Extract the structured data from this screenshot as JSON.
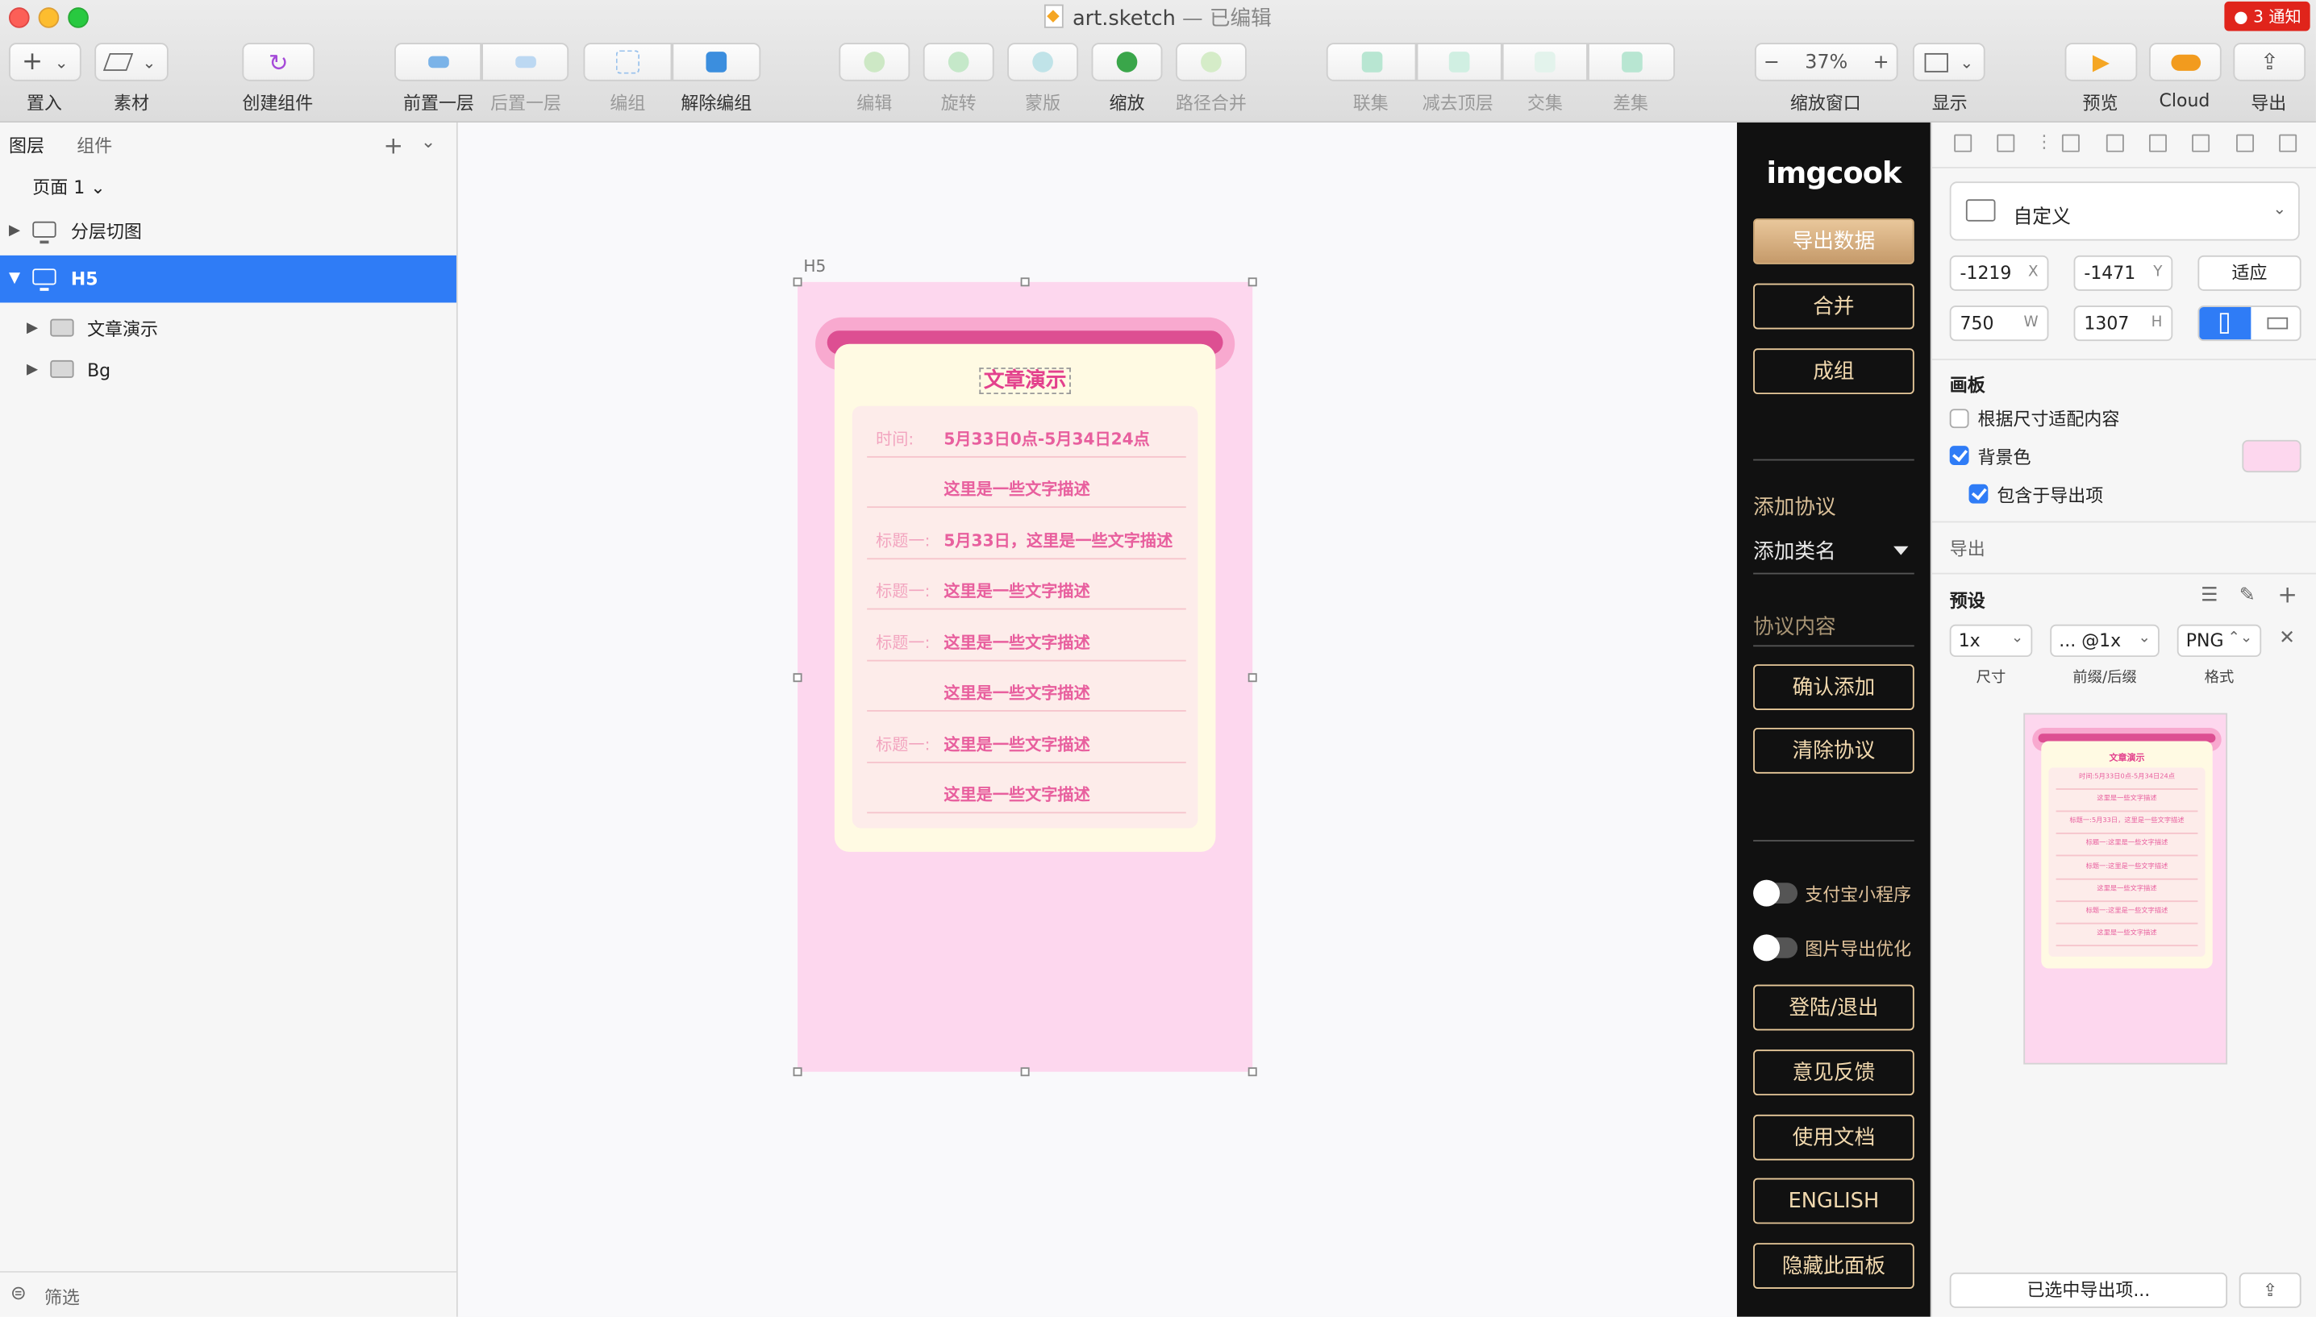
{
  "window": {
    "title": "art.sketch",
    "title_suffix": " — 已编辑",
    "notification": "● 3 通知"
  },
  "toolbar": {
    "items": [
      {
        "label": "置入",
        "state": "active"
      },
      {
        "label": "素材",
        "state": "active"
      },
      {
        "label": "创建组件",
        "state": "active"
      },
      {
        "label": "前置一层",
        "state": "active"
      },
      {
        "label": "后置一层",
        "state": "disabled"
      },
      {
        "label": "编组",
        "state": "disabled"
      },
      {
        "label": "解除编组",
        "state": "active"
      },
      {
        "label": "编辑",
        "state": "disabled"
      },
      {
        "label": "旋转",
        "state": "disabled"
      },
      {
        "label": "蒙版",
        "state": "disabled"
      },
      {
        "label": "缩放",
        "state": "active"
      },
      {
        "label": "路径合并",
        "state": "disabled"
      },
      {
        "label": "联集",
        "state": "disabled"
      },
      {
        "label": "减去顶层",
        "state": "disabled"
      },
      {
        "label": "交集",
        "state": "disabled"
      },
      {
        "label": "差集",
        "state": "disabled"
      },
      {
        "label": "缩放窗口",
        "state": "active"
      },
      {
        "label": "显示",
        "state": "active"
      },
      {
        "label": "预览",
        "state": "active"
      },
      {
        "label": "Cloud",
        "state": "active"
      },
      {
        "label": "导出",
        "state": "active"
      }
    ],
    "zoom": "37%",
    "zoom_minus": "−",
    "zoom_plus": "+",
    "insert_symbol": "+",
    "chevron": "⌄"
  },
  "left_panel": {
    "tab_layers": "图层",
    "tab_components": "组件",
    "add_symbol": "+",
    "chevron": "⌄",
    "page": "页面 1 ⌄",
    "layers": [
      {
        "name": "分层切图",
        "selected": false
      },
      {
        "name": "H5",
        "selected": true
      },
      {
        "name": "文章演示",
        "selected": false
      },
      {
        "name": "Bg",
        "selected": false
      }
    ],
    "arrow_collapsed": "▶",
    "arrow_expanded": "▼",
    "filter_icon": "⊜",
    "filter_label": "筛选"
  },
  "canvas": {
    "artboard_name": "H5",
    "card_title": "文章演示",
    "rows": [
      {
        "key": "时间:",
        "value": "5月33日0点-5月34日24点"
      },
      {
        "key": "",
        "value": "这里是一些文字描述"
      },
      {
        "key": "标题一:",
        "value": "5月33日，这里是一些文字描述"
      },
      {
        "key": "标题一:",
        "value": "这里是一些文字描述"
      },
      {
        "key": "标题一:",
        "value": "这里是一些文字描述"
      },
      {
        "key": "",
        "value": "这里是一些文字描述"
      },
      {
        "key": "标题一:",
        "value": "这里是一些文字描述"
      },
      {
        "key": "",
        "value": "这里是一些文字描述"
      }
    ]
  },
  "imgcook": {
    "logo": "imgcook",
    "export_data": "导出数据",
    "merge": "合并",
    "group": "成组",
    "add_protocol": "添加协议",
    "add_class": "添加类名",
    "protocol_content": "协议内容",
    "confirm_add": "确认添加",
    "clear_protocol": "清除协议",
    "alipay_toggle": "支付宝小程序",
    "image_opt_toggle": "图片导出优化",
    "login": "登陆/退出",
    "feedback": "意见反馈",
    "docs": "使用文档",
    "english": "ENGLISH",
    "hide_panel": "隐藏此面板"
  },
  "inspector": {
    "preset": "自定义",
    "chevron": "⌄",
    "x": "-1219",
    "x_unit": "X",
    "y": "-1471",
    "y_unit": "Y",
    "w": "750",
    "w_unit": "W",
    "h": "1307",
    "h_unit": "H",
    "fit": "适应",
    "section_artboard": "画板",
    "fit_content": "根据尺寸适配内容",
    "bg_color": "背景色",
    "include_export": "包含于导出项",
    "section_export": "导出",
    "section_preset": "预设",
    "size": "1x",
    "suffix": "... @1x",
    "format": "PNG",
    "label_size": "尺寸",
    "label_suffix": "前缀/后缀",
    "label_format": "格式",
    "remove": "✕",
    "plus": "+",
    "stepper": "⌃⌄",
    "export_selected": "已选中导出项...",
    "share_icon": "⇪",
    "bg_swatch_color": "#fdd7ee"
  },
  "colors": {
    "selection": "#2f7cf6",
    "artboard_bg": "#fdd7ee",
    "accent_pink": "#e3418d",
    "imgcook_gold": "#e8c99a"
  }
}
